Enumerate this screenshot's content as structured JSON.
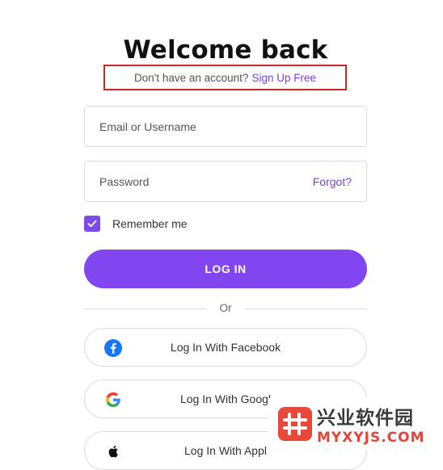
{
  "header": {
    "title": "Welcome back",
    "signup_prompt": "Don't have an account?",
    "signup_link": "Sign Up Free"
  },
  "form": {
    "username_placeholder": "Email or Username",
    "password_placeholder": "Password",
    "forgot_label": "Forgot?",
    "remember_label": "Remember me",
    "remember_checked": true,
    "login_label": "LOG IN",
    "divider_label": "Or"
  },
  "social": [
    {
      "label": "Log In With Facebook",
      "icon": "facebook-icon"
    },
    {
      "label": "Log In With Googl",
      "icon": "google-icon"
    },
    {
      "label": "Log In With Appl",
      "icon": "apple-icon"
    }
  ],
  "watermark": {
    "cn": "兴业软件园",
    "en": "MYXYJS.COM"
  },
  "colors": {
    "accent": "#8146f0",
    "link": "#7b3fe4",
    "highlight_border": "#c62828",
    "facebook": "#1877f2"
  }
}
